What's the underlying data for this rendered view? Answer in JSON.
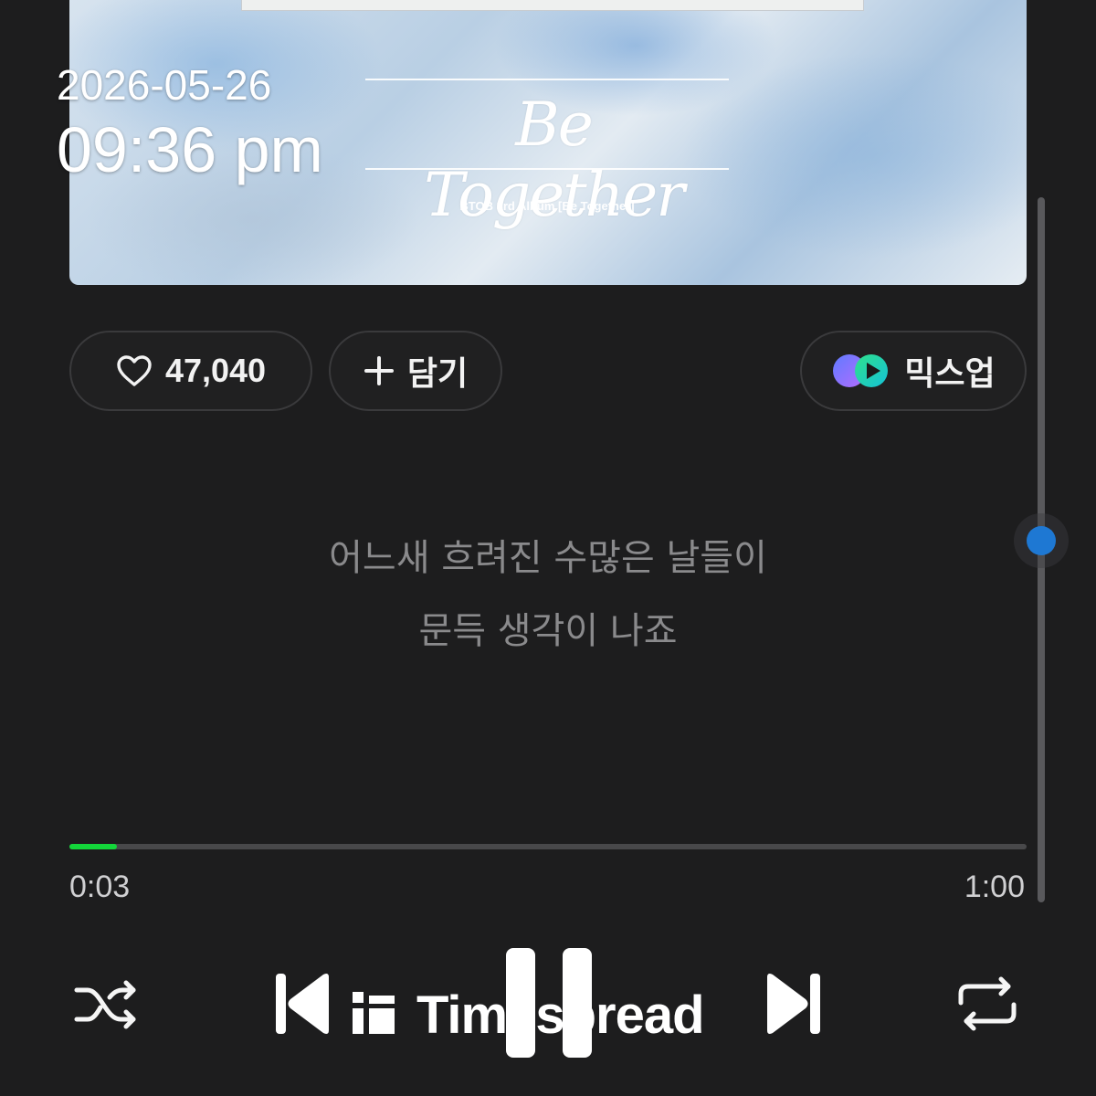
{
  "overlay": {
    "date": "2026-05-26",
    "time": "09:36 pm"
  },
  "album": {
    "title": "Be Together",
    "subtitle": "BTOB 3rd Album [Be Together]"
  },
  "actions": {
    "like_count": "47,040",
    "add_label": "담기",
    "mixup_label": "믹스업"
  },
  "lyrics": {
    "line1": "어느새 흐려진 수많은 날들이",
    "line2": "문득 생각이 나죠"
  },
  "playback": {
    "elapsed": "0:03",
    "duration": "1:00",
    "progress_fraction": 0.05,
    "scroll_fraction": 0.5
  },
  "watermark": {
    "text": "Timespread"
  },
  "colors": {
    "accent_green": "#13d63a",
    "scroll_thumb": "#1e78d3",
    "background": "#1d1d1e"
  },
  "icons": {
    "like": "heart-icon",
    "add": "plus-icon",
    "mixup": "mixup-logo-icon",
    "shuffle": "shuffle-icon",
    "prev": "skip-previous-icon",
    "pause": "pause-icon",
    "next": "skip-next-icon",
    "repeat": "repeat-icon"
  }
}
